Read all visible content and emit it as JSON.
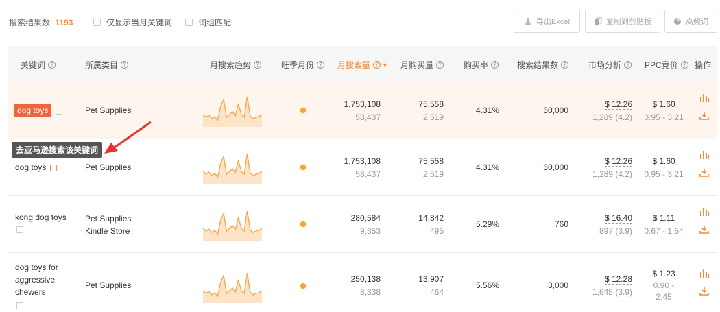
{
  "toolbar": {
    "result_label": "搜索结果数:",
    "result_count": "1193",
    "only_current_month": "仅显示当月关键词",
    "phrase_match": "词组匹配",
    "export_excel": "导出Excel",
    "copy_clipboard": "复制到剪贴板",
    "frequent_words": "高频词"
  },
  "headers": {
    "keyword": "关键词",
    "category": "所属类目",
    "trend": "月搜索趋势",
    "peak_month": "旺季月份",
    "monthly_search": "月搜索量",
    "monthly_purchase": "月购买量",
    "purchase_rate": "购买率",
    "search_results": "搜索结果数",
    "market_analysis": "市场分析",
    "ppc": "PPC竞价",
    "ops": "操作"
  },
  "tooltip": "去亚马逊搜索该关键词",
  "rows": [
    {
      "keyword": "dog toys",
      "category1": "Pet Supplies",
      "category2": "",
      "search": "1,753,108",
      "search_sub": "58,437",
      "purchase": "75,558",
      "purchase_sub": "2,519",
      "rate": "4.31%",
      "results": "60,000",
      "market": "$ 12.26",
      "market_sub": "1,289 (4.2)",
      "ppc": "$ 1.60",
      "ppc_sub": "0.95 - 3.21"
    },
    {
      "keyword": "dog toys",
      "category1": "Pet Supplies",
      "category2": "",
      "search": "1,753,108",
      "search_sub": "58,437",
      "purchase": "75,558",
      "purchase_sub": "2,519",
      "rate": "4.31%",
      "results": "60,000",
      "market": "$ 12.26",
      "market_sub": "1,289 (4.2)",
      "ppc": "$ 1.60",
      "ppc_sub": "0.95 - 3.21"
    },
    {
      "keyword": "kong dog toys",
      "category1": "Pet Supplies",
      "category2": "Kindle Store",
      "search": "280,584",
      "search_sub": "9,353",
      "purchase": "14,842",
      "purchase_sub": "495",
      "rate": "5.29%",
      "results": "760",
      "market": "$ 16.40",
      "market_sub": "897 (3.9)",
      "ppc": "$ 1.11",
      "ppc_sub": "0.67 - 1.54"
    },
    {
      "keyword_l1": "dog toys for",
      "keyword_l2": "aggressive",
      "keyword_l3": "chewers",
      "category1": "Pet Supplies",
      "category2": "",
      "search": "250,138",
      "search_sub": "8,338",
      "purchase": "13,907",
      "purchase_sub": "464",
      "rate": "5.56%",
      "results": "3,000",
      "market": "$ 12.28",
      "market_sub": "1,645 (3.9)",
      "ppc": "$ 1.23",
      "ppc_sub_l1": "0.90 -",
      "ppc_sub_l2": "2.45"
    }
  ],
  "colors": {
    "accent": "#f08c3c",
    "tag": "#f0643c",
    "highlight_row": "#fff5ef"
  }
}
